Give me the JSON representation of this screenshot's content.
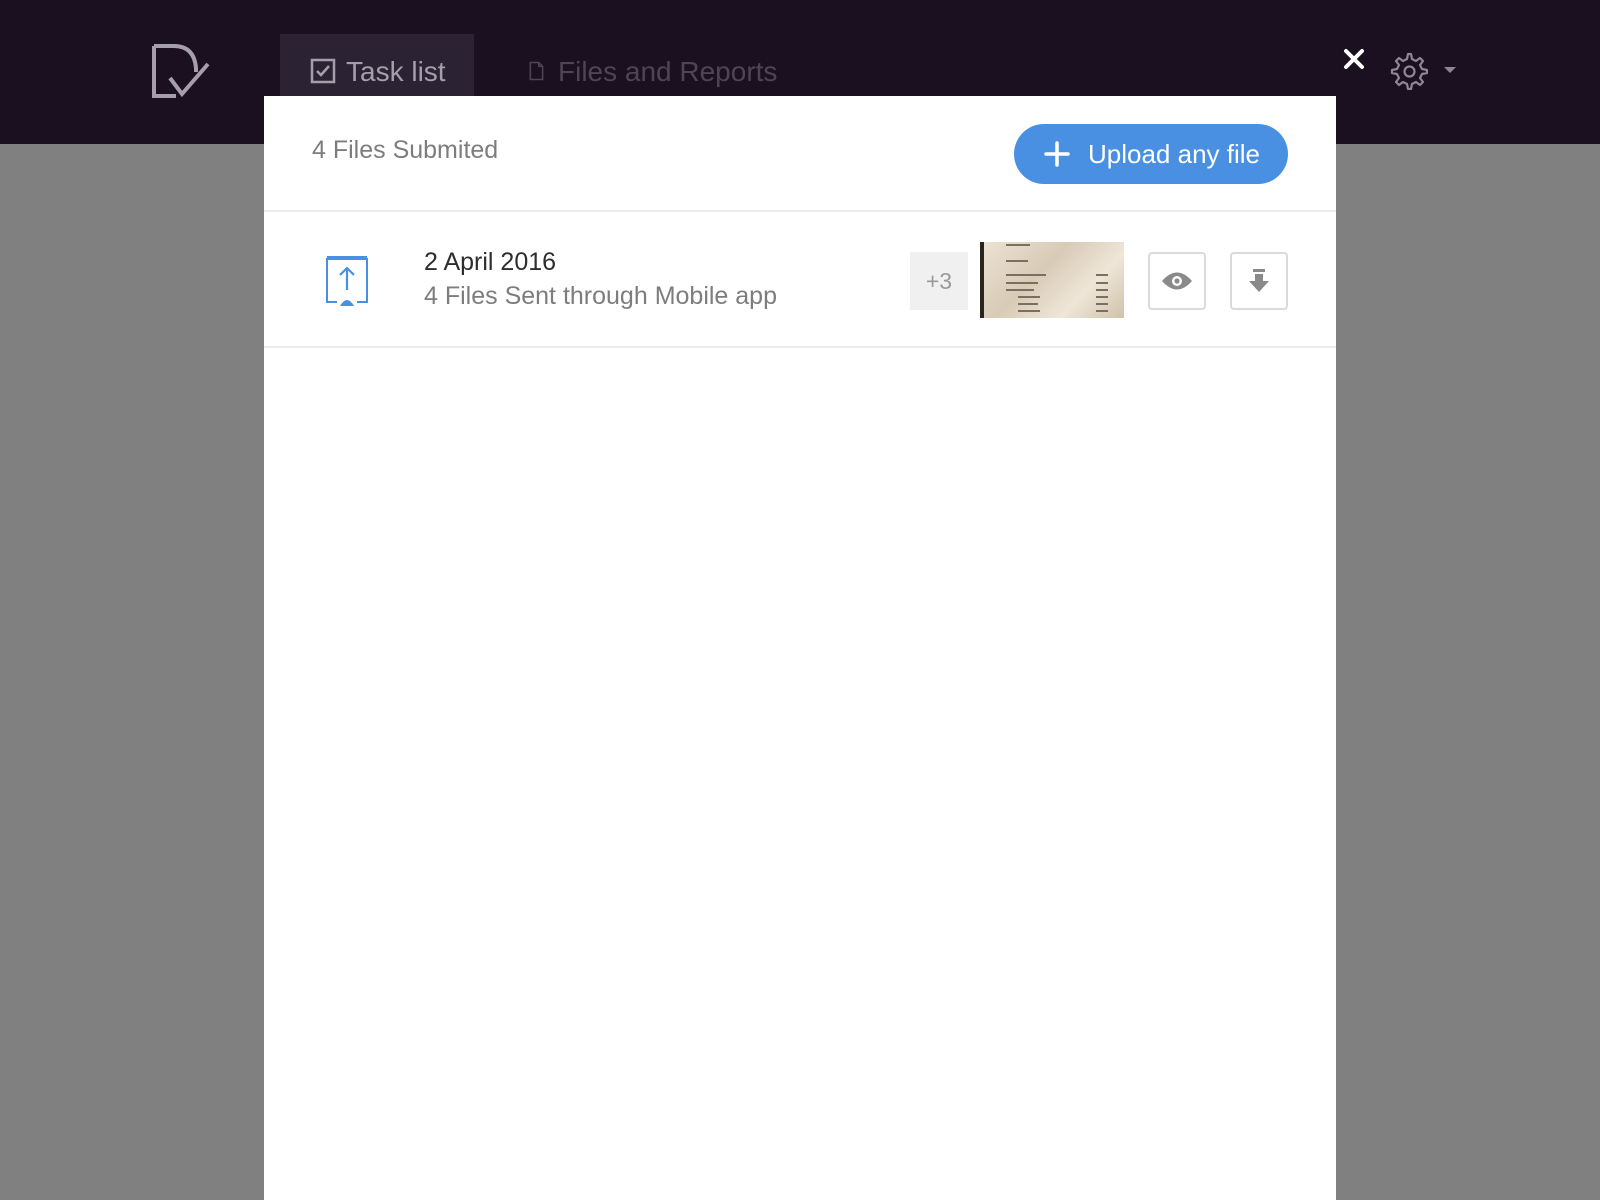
{
  "header": {
    "tabs": [
      {
        "label": "Task list",
        "icon": "checkbox-icon",
        "active": true
      },
      {
        "label": "Files and Reports",
        "icon": "document-icon",
        "active": false
      }
    ],
    "close_icon": "close-icon",
    "settings_icon": "gear-icon"
  },
  "modal": {
    "files_count": "4 Files Submited",
    "upload_label": "Upload any file",
    "rows": [
      {
        "date": "2 April 2016",
        "description": "4 Files Sent through Mobile app",
        "more_count": "+3",
        "icon": "mobile-upload-icon"
      }
    ]
  },
  "colors": {
    "header_bg": "#1a1020",
    "accent": "#4a90e2",
    "overlay": "#808080"
  }
}
